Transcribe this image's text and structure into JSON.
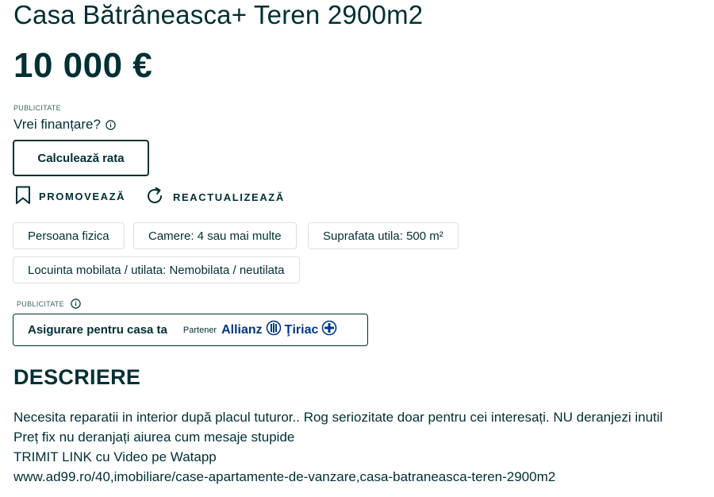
{
  "listing": {
    "title": "Casa Bătrâneasca+ Teren 2900m2",
    "price": "10 000 €"
  },
  "financing": {
    "ad_label": "PUBLICITATE",
    "question": "Vrei finanțare?",
    "calculate_label": "Calculează rata"
  },
  "actions": {
    "promote_label": "PROMOVEAZĂ",
    "refresh_label": "REACTUALIZEAZĂ"
  },
  "tags": [
    "Persoana fizica",
    "Camere: 4 sau mai multe",
    "Suprafata utila: 500 m²",
    "Locuinta mobilata / utilata: Nemobilata / neutilata"
  ],
  "insurance": {
    "ad_label": "PUBLICITATE",
    "label": "Asigurare pentru casa ta",
    "partner_label": "Partener",
    "brand_left": "Allianz",
    "brand_right": "Ţiriac",
    "brand_color": "#003781"
  },
  "description": {
    "heading": "DESCRIERE",
    "lines": [
      "Necesita reparatii in interior după placul tuturor.. Rog seriozitate doar pentru cei interesați. NU deranjezi inutil",
      "Preț fix nu deranjați aiurea cum mesaje stupide",
      "TRIMIT LINK cu Video pe Watapp",
      "www.ad99.ro/40,imobiliare/case-apartamente-de-vanzare,casa-batraneasca-teren-2900m2"
    ]
  },
  "colors": {
    "text": "#002f34",
    "border": "#d8dfe0"
  },
  "icons": [
    "info-icon",
    "bookmark-icon",
    "refresh-icon",
    "allianz-eagle-icon",
    "tiriac-cross-icon"
  ]
}
